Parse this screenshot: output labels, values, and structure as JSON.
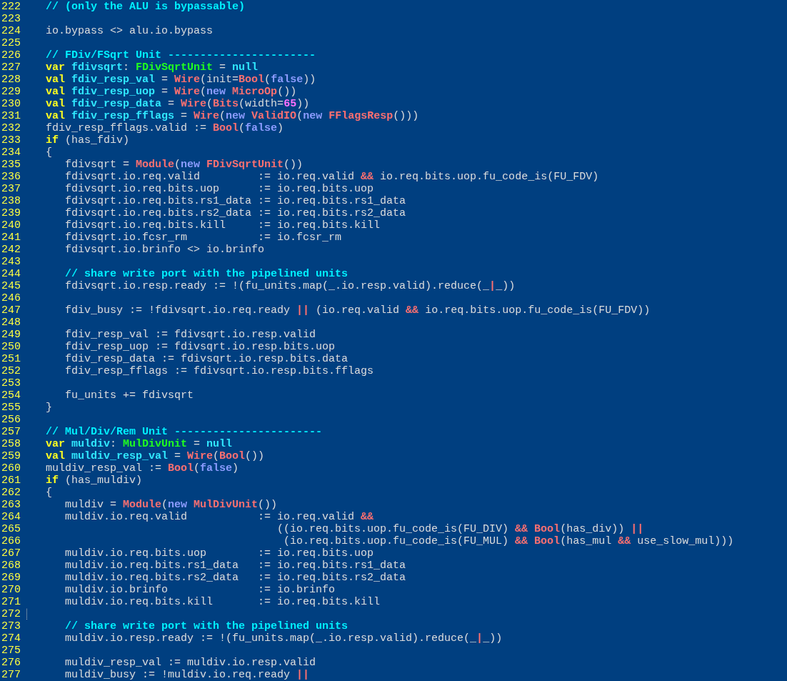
{
  "editor": {
    "lines": [
      {
        "number": "222",
        "cursor": false,
        "tokens": [
          {
            "kind": "comment",
            "text": "// (only the ALU is bypassable)"
          }
        ]
      },
      {
        "number": "223",
        "cursor": false
      },
      {
        "number": "224",
        "cursor": false,
        "tokens": [
          {
            "kind": "plain",
            "text": "io.bypass <> alu.io.bypass"
          }
        ]
      },
      {
        "number": "225",
        "cursor": false
      },
      {
        "number": "226",
        "cursor": false,
        "tokens": [
          {
            "kind": "comment",
            "text": "// FDiv/FSqrt Unit -----------------------"
          }
        ]
      },
      {
        "number": "227",
        "cursor": false,
        "tokens": [
          {
            "kind": "keyword",
            "text": "var "
          },
          {
            "kind": "name",
            "text": "fdivsqrt"
          },
          {
            "kind": "plain",
            "text": ": "
          },
          {
            "kind": "type",
            "text": "FDivSqrtUnit"
          },
          {
            "kind": "plain",
            "text": " = "
          },
          {
            "kind": "name",
            "text": "null"
          }
        ]
      },
      {
        "number": "228",
        "cursor": false,
        "tokens": [
          {
            "kind": "keyword",
            "text": "val "
          },
          {
            "kind": "name",
            "text": "fdiv_resp_val"
          },
          {
            "kind": "plain",
            "text": " = "
          },
          {
            "kind": "call",
            "text": "Wire"
          },
          {
            "kind": "plain",
            "text": "(init="
          },
          {
            "kind": "call",
            "text": "Bool"
          },
          {
            "kind": "plain",
            "text": "("
          },
          {
            "kind": "literal",
            "text": "false"
          },
          {
            "kind": "plain",
            "text": "))"
          }
        ]
      },
      {
        "number": "229",
        "cursor": false,
        "tokens": [
          {
            "kind": "keyword",
            "text": "val "
          },
          {
            "kind": "name",
            "text": "fdiv_resp_uop"
          },
          {
            "kind": "plain",
            "text": " = "
          },
          {
            "kind": "call",
            "text": "Wire"
          },
          {
            "kind": "plain",
            "text": "("
          },
          {
            "kind": "literal",
            "text": "new "
          },
          {
            "kind": "call",
            "text": "MicroOp"
          },
          {
            "kind": "plain",
            "text": "())"
          }
        ]
      },
      {
        "number": "230",
        "cursor": false,
        "tokens": [
          {
            "kind": "keyword",
            "text": "val "
          },
          {
            "kind": "name",
            "text": "fdiv_resp_data"
          },
          {
            "kind": "plain",
            "text": " = "
          },
          {
            "kind": "call",
            "text": "Wire"
          },
          {
            "kind": "plain",
            "text": "("
          },
          {
            "kind": "call",
            "text": "Bits"
          },
          {
            "kind": "plain",
            "text": "(width="
          },
          {
            "kind": "number",
            "text": "65"
          },
          {
            "kind": "plain",
            "text": "))"
          }
        ]
      },
      {
        "number": "231",
        "cursor": false,
        "tokens": [
          {
            "kind": "keyword",
            "text": "val "
          },
          {
            "kind": "name",
            "text": "fdiv_resp_fflags"
          },
          {
            "kind": "plain",
            "text": " = "
          },
          {
            "kind": "call",
            "text": "Wire"
          },
          {
            "kind": "plain",
            "text": "("
          },
          {
            "kind": "literal",
            "text": "new "
          },
          {
            "kind": "call",
            "text": "ValidIO"
          },
          {
            "kind": "plain",
            "text": "("
          },
          {
            "kind": "literal",
            "text": "new "
          },
          {
            "kind": "call",
            "text": "FFlagsResp"
          },
          {
            "kind": "plain",
            "text": "()))"
          }
        ]
      },
      {
        "number": "232",
        "cursor": false,
        "tokens": [
          {
            "kind": "plain",
            "text": "fdiv_resp_fflags.valid := "
          },
          {
            "kind": "call",
            "text": "Bool"
          },
          {
            "kind": "plain",
            "text": "("
          },
          {
            "kind": "literal",
            "text": "false"
          },
          {
            "kind": "plain",
            "text": ")"
          }
        ]
      },
      {
        "number": "233",
        "cursor": false,
        "tokens": [
          {
            "kind": "keyword",
            "text": "if"
          },
          {
            "kind": "plain",
            "text": " (has_fdiv)"
          }
        ]
      },
      {
        "number": "234",
        "cursor": false,
        "tokens": [
          {
            "kind": "plain",
            "text": "{"
          }
        ]
      },
      {
        "number": "235",
        "cursor": false,
        "tokens": [
          {
            "kind": "plain",
            "text": "   fdivsqrt = "
          },
          {
            "kind": "call",
            "text": "Module"
          },
          {
            "kind": "plain",
            "text": "("
          },
          {
            "kind": "literal",
            "text": "new "
          },
          {
            "kind": "call",
            "text": "FDivSqrtUnit"
          },
          {
            "kind": "plain",
            "text": "())"
          }
        ]
      },
      {
        "number": "236",
        "cursor": false,
        "tokens": [
          {
            "kind": "plain",
            "text": "   fdivsqrt.io.req.valid         := io.req.valid "
          },
          {
            "kind": "call",
            "text": "&&"
          },
          {
            "kind": "plain",
            "text": " io.req.bits.uop.fu_code_is(FU_FDV)"
          }
        ]
      },
      {
        "number": "237",
        "cursor": false,
        "tokens": [
          {
            "kind": "plain",
            "text": "   fdivsqrt.io.req.bits.uop      := io.req.bits.uop"
          }
        ]
      },
      {
        "number": "238",
        "cursor": false,
        "tokens": [
          {
            "kind": "plain",
            "text": "   fdivsqrt.io.req.bits.rs1_data := io.req.bits.rs1_data"
          }
        ]
      },
      {
        "number": "239",
        "cursor": false,
        "tokens": [
          {
            "kind": "plain",
            "text": "   fdivsqrt.io.req.bits.rs2_data := io.req.bits.rs2_data"
          }
        ]
      },
      {
        "number": "240",
        "cursor": false,
        "tokens": [
          {
            "kind": "plain",
            "text": "   fdivsqrt.io.req.bits.kill     := io.req.bits.kill"
          }
        ]
      },
      {
        "number": "241",
        "cursor": false,
        "tokens": [
          {
            "kind": "plain",
            "text": "   fdivsqrt.io.fcsr_rm           := io.fcsr_rm"
          }
        ]
      },
      {
        "number": "242",
        "cursor": false,
        "tokens": [
          {
            "kind": "plain",
            "text": "   fdivsqrt.io.brinfo <> io.brinfo"
          }
        ]
      },
      {
        "number": "243",
        "cursor": false
      },
      {
        "number": "244",
        "cursor": false,
        "tokens": [
          {
            "kind": "comment",
            "text": "   // share write port with the pipelined units"
          }
        ]
      },
      {
        "number": "245",
        "cursor": false,
        "tokens": [
          {
            "kind": "plain",
            "text": "   fdivsqrt.io.resp.ready := !(fu_units.map(_.io.resp.valid).reduce(_"
          },
          {
            "kind": "call",
            "text": "|"
          },
          {
            "kind": "plain",
            "text": "_))"
          }
        ]
      },
      {
        "number": "246",
        "cursor": false
      },
      {
        "number": "247",
        "cursor": false,
        "tokens": [
          {
            "kind": "plain",
            "text": "   fdiv_busy := !fdivsqrt.io.req.ready "
          },
          {
            "kind": "call",
            "text": "||"
          },
          {
            "kind": "plain",
            "text": " (io.req.valid "
          },
          {
            "kind": "call",
            "text": "&&"
          },
          {
            "kind": "plain",
            "text": " io.req.bits.uop.fu_code_is(FU_FDV))"
          }
        ]
      },
      {
        "number": "248",
        "cursor": false
      },
      {
        "number": "249",
        "cursor": false,
        "tokens": [
          {
            "kind": "plain",
            "text": "   fdiv_resp_val := fdivsqrt.io.resp.valid"
          }
        ]
      },
      {
        "number": "250",
        "cursor": false,
        "tokens": [
          {
            "kind": "plain",
            "text": "   fdiv_resp_uop := fdivsqrt.io.resp.bits.uop"
          }
        ]
      },
      {
        "number": "251",
        "cursor": false,
        "tokens": [
          {
            "kind": "plain",
            "text": "   fdiv_resp_data := fdivsqrt.io.resp.bits.data"
          }
        ]
      },
      {
        "number": "252",
        "cursor": false,
        "tokens": [
          {
            "kind": "plain",
            "text": "   fdiv_resp_fflags := fdivsqrt.io.resp.bits.fflags"
          }
        ]
      },
      {
        "number": "253",
        "cursor": false
      },
      {
        "number": "254",
        "cursor": false,
        "tokens": [
          {
            "kind": "plain",
            "text": "   fu_units += fdivsqrt"
          }
        ]
      },
      {
        "number": "255",
        "cursor": false,
        "tokens": [
          {
            "kind": "plain",
            "text": "}"
          }
        ]
      },
      {
        "number": "256",
        "cursor": false
      },
      {
        "number": "257",
        "cursor": false,
        "tokens": [
          {
            "kind": "comment",
            "text": "// Mul/Div/Rem Unit -----------------------"
          }
        ]
      },
      {
        "number": "258",
        "cursor": false,
        "tokens": [
          {
            "kind": "keyword",
            "text": "var "
          },
          {
            "kind": "name",
            "text": "muldiv"
          },
          {
            "kind": "plain",
            "text": ": "
          },
          {
            "kind": "type",
            "text": "MulDivUnit"
          },
          {
            "kind": "plain",
            "text": " = "
          },
          {
            "kind": "name",
            "text": "null"
          }
        ]
      },
      {
        "number": "259",
        "cursor": false,
        "tokens": [
          {
            "kind": "keyword",
            "text": "val "
          },
          {
            "kind": "name",
            "text": "muldiv_resp_val"
          },
          {
            "kind": "plain",
            "text": " = "
          },
          {
            "kind": "call",
            "text": "Wire"
          },
          {
            "kind": "plain",
            "text": "("
          },
          {
            "kind": "call",
            "text": "Bool"
          },
          {
            "kind": "plain",
            "text": "())"
          }
        ]
      },
      {
        "number": "260",
        "cursor": false,
        "tokens": [
          {
            "kind": "plain",
            "text": "muldiv_resp_val := "
          },
          {
            "kind": "call",
            "text": "Bool"
          },
          {
            "kind": "plain",
            "text": "("
          },
          {
            "kind": "literal",
            "text": "false"
          },
          {
            "kind": "plain",
            "text": ")"
          }
        ]
      },
      {
        "number": "261",
        "cursor": false,
        "tokens": [
          {
            "kind": "keyword",
            "text": "if"
          },
          {
            "kind": "plain",
            "text": " (has_muldiv)"
          }
        ]
      },
      {
        "number": "262",
        "cursor": false,
        "tokens": [
          {
            "kind": "plain",
            "text": "{"
          }
        ]
      },
      {
        "number": "263",
        "cursor": false,
        "tokens": [
          {
            "kind": "plain",
            "text": "   muldiv = "
          },
          {
            "kind": "call",
            "text": "Module"
          },
          {
            "kind": "plain",
            "text": "("
          },
          {
            "kind": "literal",
            "text": "new "
          },
          {
            "kind": "call",
            "text": "MulDivUnit"
          },
          {
            "kind": "plain",
            "text": "())"
          }
        ]
      },
      {
        "number": "264",
        "cursor": false,
        "tokens": [
          {
            "kind": "plain",
            "text": "   muldiv.io.req.valid           := io.req.valid "
          },
          {
            "kind": "call",
            "text": "&&"
          }
        ]
      },
      {
        "number": "265",
        "cursor": false,
        "tokens": [
          {
            "kind": "plain",
            "text": "                                    ((io.req.bits.uop.fu_code_is(FU_DIV) "
          },
          {
            "kind": "call",
            "text": "&& Bool"
          },
          {
            "kind": "plain",
            "text": "(has_div)) "
          },
          {
            "kind": "call",
            "text": "||"
          }
        ]
      },
      {
        "number": "266",
        "cursor": false,
        "tokens": [
          {
            "kind": "plain",
            "text": "                                     (io.req.bits.uop.fu_code_is(FU_MUL) "
          },
          {
            "kind": "call",
            "text": "&& Bool"
          },
          {
            "kind": "plain",
            "text": "(has_mul "
          },
          {
            "kind": "call",
            "text": "&&"
          },
          {
            "kind": "plain",
            "text": " use_slow_mul)))"
          }
        ]
      },
      {
        "number": "267",
        "cursor": false,
        "tokens": [
          {
            "kind": "plain",
            "text": "   muldiv.io.req.bits.uop        := io.req.bits.uop"
          }
        ]
      },
      {
        "number": "268",
        "cursor": false,
        "tokens": [
          {
            "kind": "plain",
            "text": "   muldiv.io.req.bits.rs1_data   := io.req.bits.rs1_data"
          }
        ]
      },
      {
        "number": "269",
        "cursor": false,
        "tokens": [
          {
            "kind": "plain",
            "text": "   muldiv.io.req.bits.rs2_data   := io.req.bits.rs2_data"
          }
        ]
      },
      {
        "number": "270",
        "cursor": false,
        "tokens": [
          {
            "kind": "plain",
            "text": "   muldiv.io.brinfo              := io.brinfo"
          }
        ]
      },
      {
        "number": "271",
        "cursor": false,
        "tokens": [
          {
            "kind": "plain",
            "text": "   muldiv.io.req.bits.kill       := io.req.bits.kill"
          }
        ]
      },
      {
        "number": "272",
        "cursor": true
      },
      {
        "number": "273",
        "cursor": false,
        "tokens": [
          {
            "kind": "comment",
            "text": "   // share write port with the pipelined units"
          }
        ]
      },
      {
        "number": "274",
        "cursor": false,
        "tokens": [
          {
            "kind": "plain",
            "text": "   muldiv.io.resp.ready := !(fu_units.map(_.io.resp.valid).reduce(_"
          },
          {
            "kind": "call",
            "text": "|"
          },
          {
            "kind": "plain",
            "text": "_))"
          }
        ]
      },
      {
        "number": "275",
        "cursor": false
      },
      {
        "number": "276",
        "cursor": false,
        "tokens": [
          {
            "kind": "plain",
            "text": "   muldiv_resp_val := muldiv.io.resp.valid"
          }
        ]
      },
      {
        "number": "277",
        "cursor": false,
        "tokens": [
          {
            "kind": "plain",
            "text": "   muldiv_busy := !muldiv.io.req.ready "
          },
          {
            "kind": "call",
            "text": "||"
          }
        ]
      }
    ]
  }
}
